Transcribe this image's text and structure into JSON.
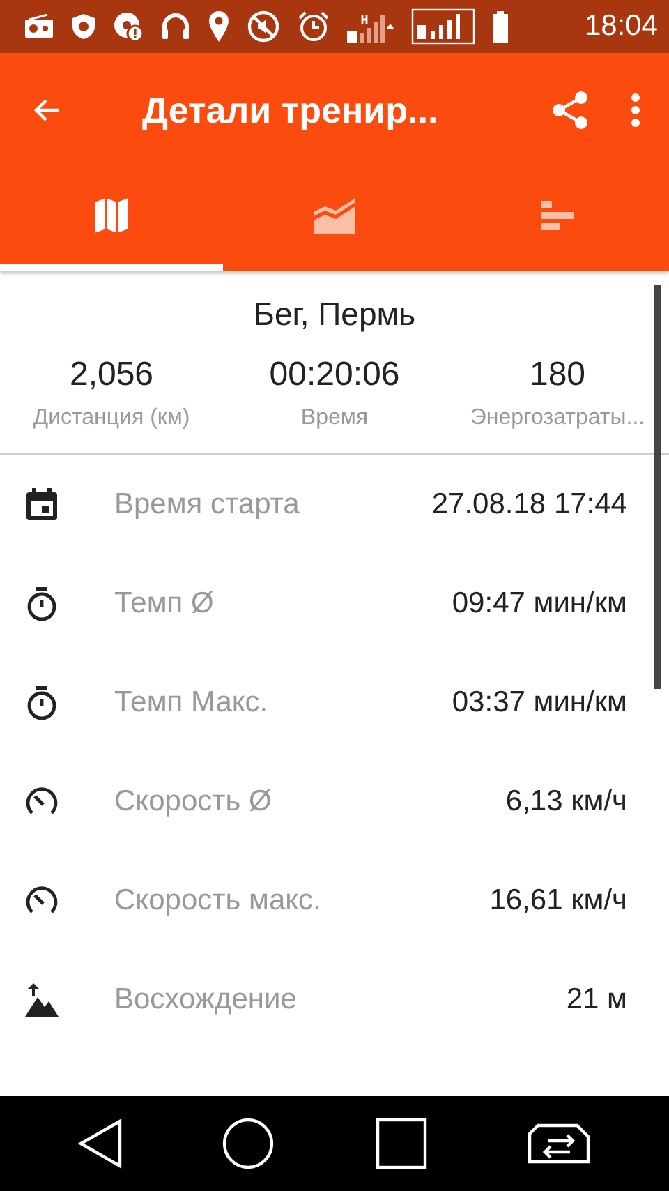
{
  "status_bar": {
    "time": "18:04"
  },
  "toolbar": {
    "title": "Детали тренир..."
  },
  "tabs": [
    {
      "kind": "map",
      "selected": true
    },
    {
      "kind": "chart",
      "selected": false
    },
    {
      "kind": "bars",
      "selected": false
    }
  ],
  "summary": {
    "title": "Бег, Пермь",
    "stats": [
      {
        "value": "2,056",
        "label": "Дистанция (км)"
      },
      {
        "value": "00:20:06",
        "label": "Время"
      },
      {
        "value": "180",
        "label": "Энергозатраты..."
      }
    ]
  },
  "details": [
    {
      "kind": "calendar",
      "label": "Время старта",
      "value": "27.08.18 17:44"
    },
    {
      "kind": "stopwatch",
      "label": "Темп Ø",
      "value": "09:47 мин/км"
    },
    {
      "kind": "stopwatch",
      "label": "Темп Макс.",
      "value": "03:37 мин/км"
    },
    {
      "kind": "speed",
      "label": "Скорость Ø",
      "value": "6,13 км/ч"
    },
    {
      "kind": "speed",
      "label": "Скорость макс.",
      "value": "16,61 км/ч"
    },
    {
      "kind": "ascent",
      "label": "Восхождение",
      "value": "21 м"
    }
  ]
}
